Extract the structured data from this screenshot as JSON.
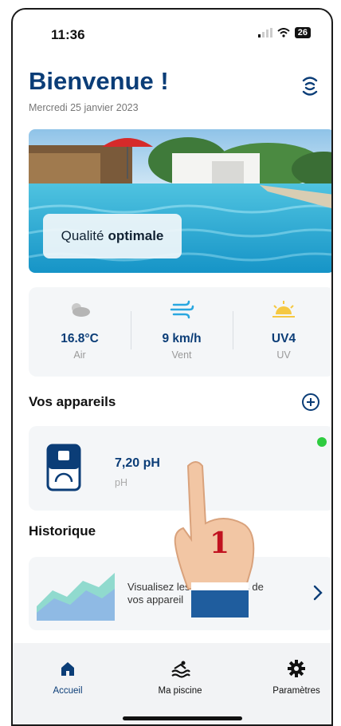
{
  "status_bar": {
    "time": "11:36",
    "battery": "26"
  },
  "header": {
    "title": "Bienvenue !",
    "date": "Mercredi 25 janvier 2023"
  },
  "hero": {
    "quality_prefix": "Qualité",
    "quality_value": "optimale"
  },
  "weather": [
    {
      "icon": "partly-cloudy-icon",
      "value": "16.8°C",
      "label": "Air"
    },
    {
      "icon": "wind-icon",
      "value": "9 km/h",
      "label": "Vent"
    },
    {
      "icon": "sun-icon",
      "value": "UV4",
      "label": "UV"
    }
  ],
  "devices": {
    "title": "Vos appareils",
    "items": [
      {
        "value": "7,20 pH",
        "unit": "pH",
        "status": "online"
      }
    ]
  },
  "history": {
    "title": "Historique",
    "text_line1": "Visualisez les",
    "text_line1_end": "ues de",
    "text_line2": "vos appareil"
  },
  "tabs": [
    {
      "label": "Accueil",
      "icon": "home-icon",
      "active": true
    },
    {
      "label": "Ma piscine",
      "icon": "pool-icon",
      "active": false
    },
    {
      "label": "Paramètres",
      "icon": "gear-icon",
      "active": false
    }
  ],
  "overlay": {
    "step_number": "1"
  },
  "colors": {
    "brand_dark": "#0b3d77",
    "accent_blue": "#1a73b8",
    "status_green": "#2ecc40",
    "sun_yellow": "#f5c842",
    "step_red": "#c1121f"
  }
}
